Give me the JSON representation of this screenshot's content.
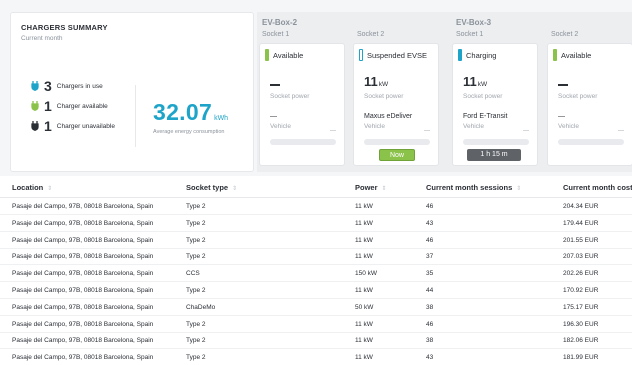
{
  "summary": {
    "title": "CHARGERS SUMMARY",
    "subtitle": "Current month",
    "stats": [
      {
        "count": "3",
        "label": "Chargers in use",
        "icon": "plug-icon",
        "color": "#1fa4c9"
      },
      {
        "count": "1",
        "label": "Charger available",
        "icon": "plug-icon",
        "color": "#8bc34a"
      },
      {
        "count": "1",
        "label": "Charger unavailable",
        "icon": "plug-icon",
        "color": "#2b2f36"
      }
    ],
    "energy_value": "32.07",
    "energy_unit": "kWh",
    "energy_caption": "Average energy consumption"
  },
  "chargers": [
    {
      "name": "EV-Box-2",
      "sockets": [
        {
          "label": "Socket 1",
          "status": "Available",
          "status_color": "#8bc34a",
          "power": "—",
          "power_unit": "",
          "power_caption": "Socket power",
          "vehicle": "—",
          "vehicle_caption": "Vehicle",
          "mini": "—",
          "badge": ""
        },
        {
          "label": "Socket 2",
          "status": "Suspended EVSE",
          "status_color": "#1fa4c9",
          "power": "11",
          "power_unit": "kW",
          "power_caption": "Socket power",
          "vehicle": "Maxus eDeliver",
          "vehicle_caption": "Vehicle",
          "mini": "—",
          "badge": "Now"
        }
      ]
    },
    {
      "name": "EV-Box-3",
      "sockets": [
        {
          "label": "Socket 1",
          "status": "Charging",
          "status_color": "#1fa4c9",
          "power": "11",
          "power_unit": "kW",
          "power_caption": "Socket power",
          "vehicle": "Ford E-Transit",
          "vehicle_caption": "Vehicle",
          "mini": "—",
          "badge": "1 h 15 m"
        },
        {
          "label": "Socket 2",
          "status": "Available",
          "status_color": "#8bc34a",
          "power": "—",
          "power_unit": "",
          "power_caption": "Socket power",
          "vehicle": "—",
          "vehicle_caption": "Vehicle",
          "mini": "—",
          "badge": ""
        }
      ]
    }
  ],
  "table": {
    "columns": [
      "Location",
      "Socket type",
      "Power",
      "Current month sessions",
      "Current month cost"
    ],
    "rows": [
      [
        "Pasaje del Campo, 97B, 08018 Barcelona, Spain",
        "Type 2",
        "11 kW",
        "46",
        "204.34 EUR"
      ],
      [
        "Pasaje del Campo, 97B, 08018 Barcelona, Spain",
        "Type 2",
        "11 kW",
        "43",
        "179.44 EUR"
      ],
      [
        "Pasaje del Campo, 97B, 08018 Barcelona, Spain",
        "Type 2",
        "11 kW",
        "46",
        "201.55 EUR"
      ],
      [
        "Pasaje del Campo, 97B, 08018 Barcelona, Spain",
        "Type 2",
        "11 kW",
        "37",
        "207.03 EUR"
      ],
      [
        "Pasaje del Campo, 97B, 08018 Barcelona, Spain",
        "CCS",
        "150 kW",
        "35",
        "202.26 EUR"
      ],
      [
        "Pasaje del Campo, 97B, 08018 Barcelona, Spain",
        "Type 2",
        "11 kW",
        "44",
        "170.92 EUR"
      ],
      [
        "Pasaje del Campo, 97B, 08018 Barcelona, Spain",
        "ChaDeMo",
        "50 kW",
        "38",
        "175.17 EUR"
      ],
      [
        "Pasaje del Campo, 97B, 08018 Barcelona, Spain",
        "Type 2",
        "11 kW",
        "46",
        "196.30 EUR"
      ],
      [
        "Pasaje del Campo, 97B, 08018 Barcelona, Spain",
        "Type 2",
        "11 kW",
        "38",
        "182.06 EUR"
      ],
      [
        "Pasaje del Campo, 97B, 08018 Barcelona, Spain",
        "Type 2",
        "11 kW",
        "43",
        "181.99 EUR"
      ]
    ]
  }
}
